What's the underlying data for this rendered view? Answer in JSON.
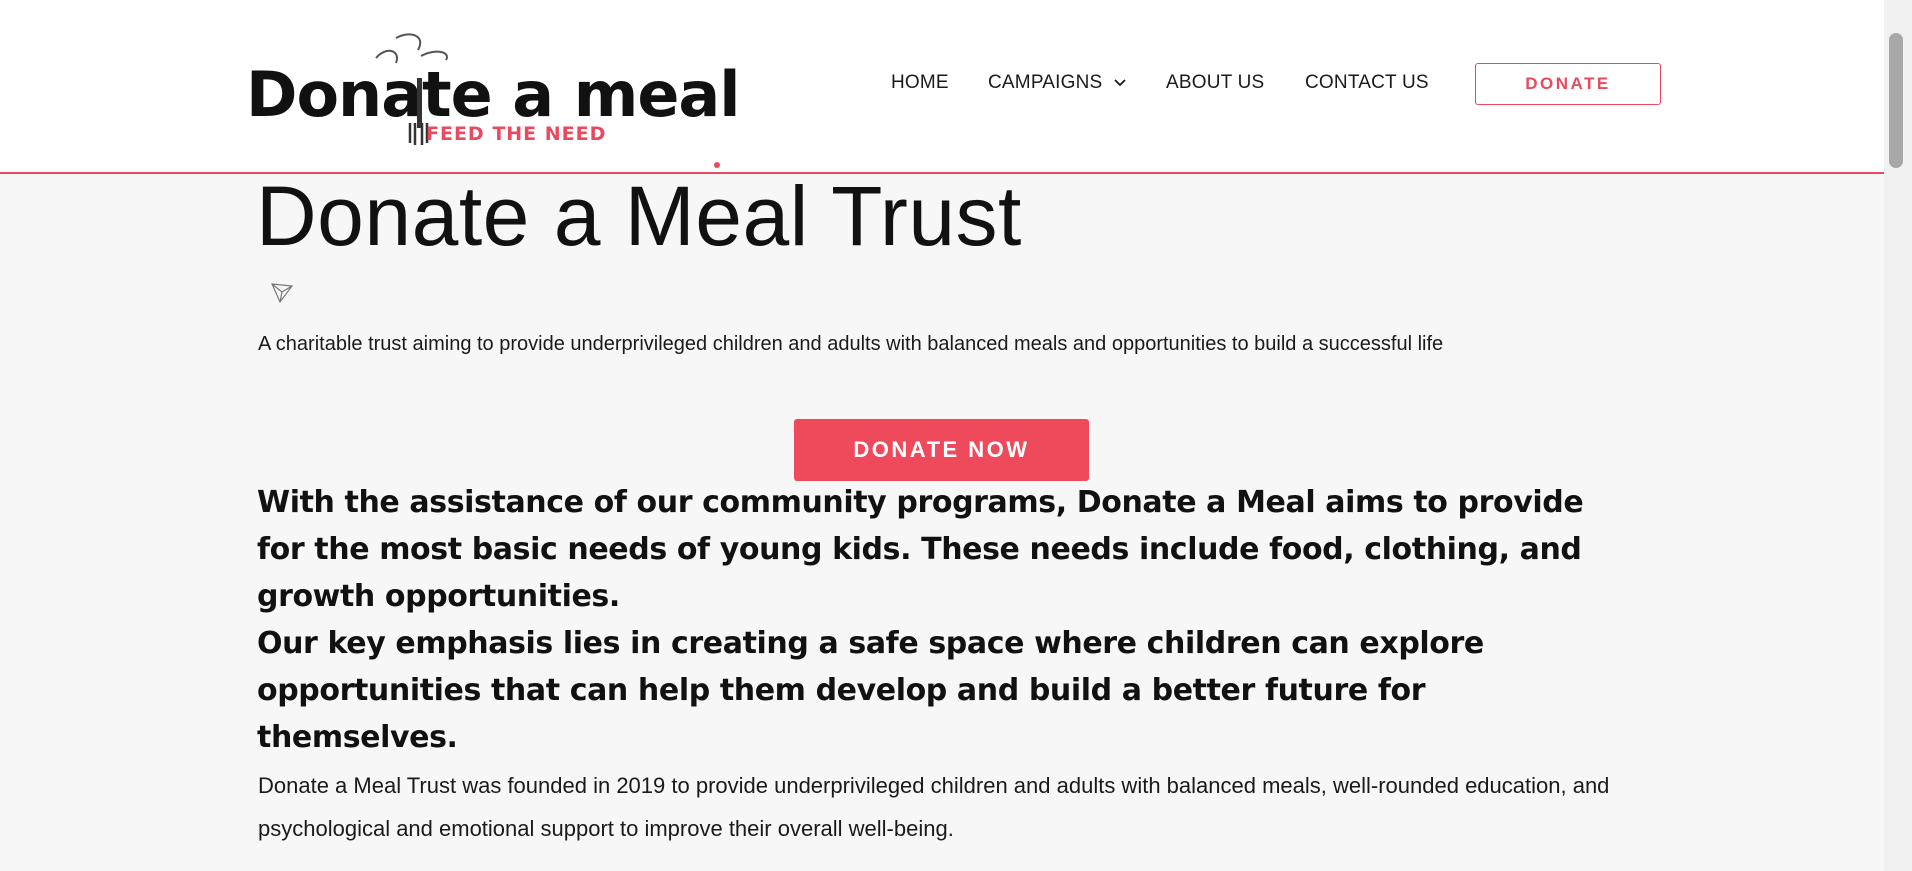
{
  "brand": {
    "logo_text": "Donate a meal",
    "tagline": "FEED THE NEED",
    "accent_color": "#e84a5f"
  },
  "nav": {
    "items": [
      {
        "label": "HOME"
      },
      {
        "label": "CAMPAIGNS"
      },
      {
        "label": "ABOUT US"
      },
      {
        "label": "CONTACT US"
      }
    ],
    "donate_label": "DONATE"
  },
  "hero": {
    "title": "Donate a Meal Trust",
    "icon": "send-icon",
    "subtitle": "A charitable trust aiming to provide underprivileged children and adults with balanced meals and opportunities to build a successful life",
    "cta_label": "DONATE NOW"
  },
  "emphasis": {
    "paragraph1": "With the assistance of our community programs, Donate a Meal aims to provide for the most basic needs of young kids. These needs include food, clothing, and growth opportunities.",
    "paragraph2": "Our key emphasis lies in creating a safe space where children can explore opportunities that can help them develop and build a better future for themselves."
  },
  "about": {
    "text": "Donate a Meal Trust was founded in 2019 to provide underprivileged children and adults with balanced meals, well-rounded education, and psychological and emotional support to improve their overall well-being."
  }
}
